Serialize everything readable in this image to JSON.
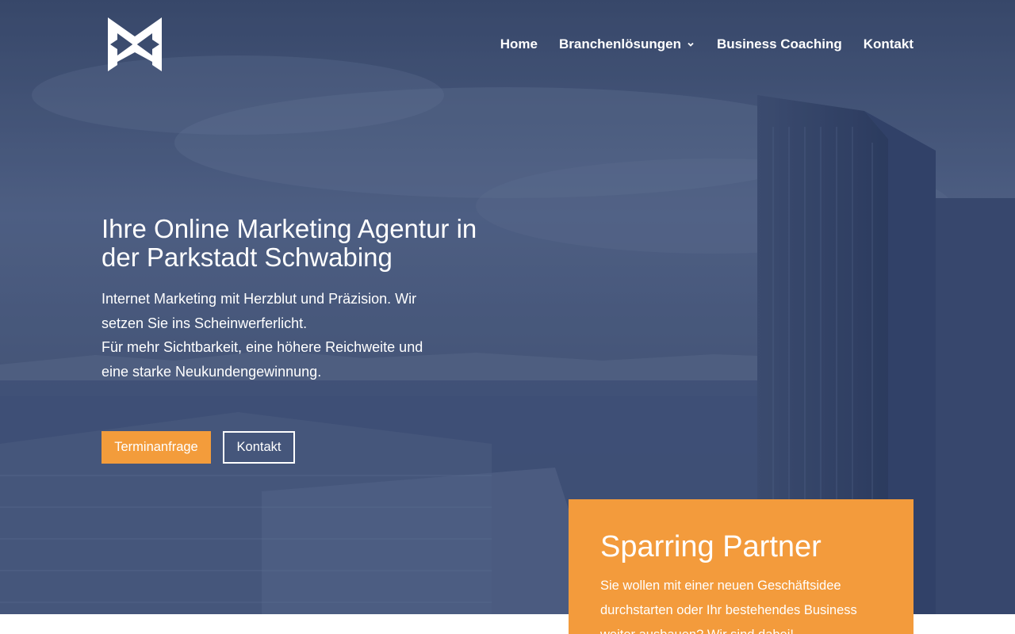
{
  "nav": {
    "items": [
      {
        "label": "Home"
      },
      {
        "label": "Branchenlösungen",
        "has_dropdown": true
      },
      {
        "label": "Business Coaching"
      },
      {
        "label": "Kontakt"
      }
    ]
  },
  "hero": {
    "title": "Ihre Online Marketing Agentur in der Parkstadt Schwabing",
    "text_line1": "Internet Marketing mit Herzblut und Präzision. Wir setzen Sie ins Scheinwerferlicht.",
    "text_line2": "Für mehr Sichtbarkeit, eine höhere Reichweite und eine starke Neukundengewinnung.",
    "primary_button": "Terminanfrage",
    "secondary_button": "Kontakt"
  },
  "card": {
    "title": "Sparring Partner",
    "text": "Sie wollen mit einer neuen Geschäftsidee durchstarten oder Ihr bestehendes Business weiter ausbauen? Wir sind dabei!"
  },
  "colors": {
    "accent": "#f39b3c",
    "overlay": "#3d4d6e",
    "text": "#ffffff"
  },
  "icons": {
    "logo": "mw-logo-icon",
    "dropdown": "chevron-down-icon"
  }
}
